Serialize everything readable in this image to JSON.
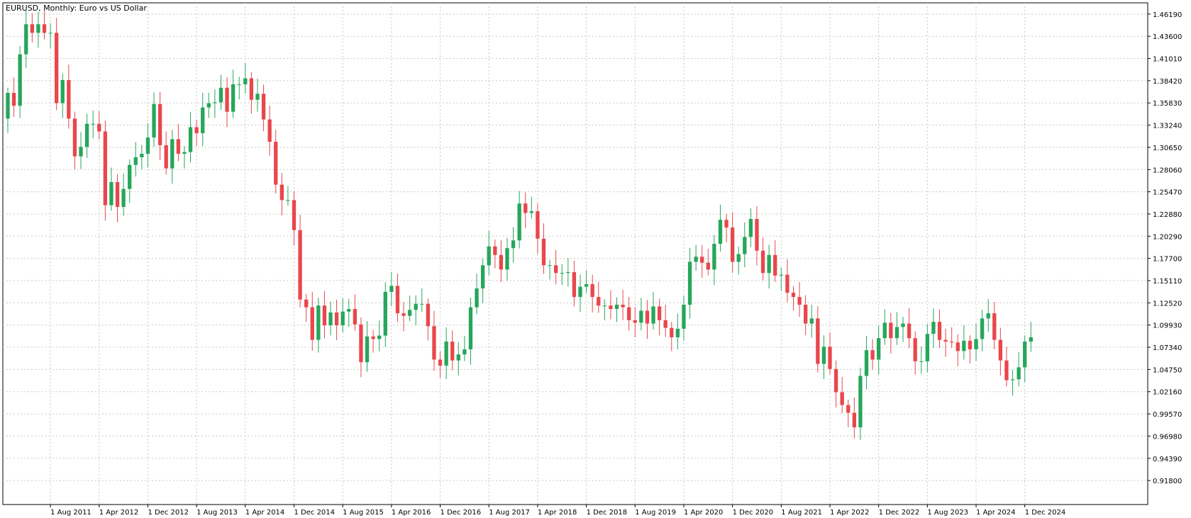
{
  "chart_data": {
    "type": "candlestick",
    "title": "EURUSD, Monthly:  Euro vs US Dollar",
    "ylim": [
      0.89,
      1.475
    ],
    "y_ticks": [
      "1.46190",
      "1.43600",
      "1.41010",
      "1.38420",
      "1.35830",
      "1.33240",
      "1.30650",
      "1.28060",
      "1.25470",
      "1.22880",
      "1.20290",
      "1.17700",
      "1.15110",
      "1.12520",
      "1.09930",
      "1.07340",
      "1.04750",
      "1.02160",
      "0.99570",
      "0.96980",
      "0.94390",
      "0.91800"
    ],
    "x_labels": [
      "1 Aug 2011",
      "1 Apr 2012",
      "1 Dec 2012",
      "1 Aug 2013",
      "1 Apr 2014",
      "1 Dec 2014",
      "1 Aug 2015",
      "1 Apr 2016",
      "1 Dec 2016",
      "1 Aug 2017",
      "1 Apr 2018",
      "1 Dec 2018",
      "1 Aug 2019",
      "1 Apr 2020",
      "1 Dec 2020",
      "1 Aug 2021",
      "1 Apr 2022",
      "1 Dec 2022",
      "1 Aug 2023",
      "1 Apr 2024",
      "1 Dec 2024"
    ],
    "start": "2011-01",
    "up_color": "#26a65b",
    "down_color": "#e8474c",
    "closes": [
      1.37,
      1.355,
      1.415,
      1.45,
      1.44,
      1.45,
      1.44,
      1.44,
      1.358,
      1.385,
      1.34,
      1.296,
      1.307,
      1.334,
      1.334,
      1.325,
      1.239,
      1.266,
      1.237,
      1.258,
      1.286,
      1.295,
      1.299,
      1.318,
      1.357,
      1.309,
      1.282,
      1.316,
      1.299,
      1.301,
      1.33,
      1.323,
      1.353,
      1.358,
      1.359,
      1.376,
      1.348,
      1.38,
      1.38,
      1.387,
      1.362,
      1.369,
      1.339,
      1.313,
      1.263,
      1.245,
      1.245,
      1.21,
      1.129,
      1.12,
      1.082,
      1.122,
      1.099,
      1.114,
      1.099,
      1.115,
      1.118,
      1.1,
      1.056,
      1.086,
      1.083,
      1.087,
      1.138,
      1.145,
      1.113,
      1.11,
      1.117,
      1.124,
      1.124,
      1.098,
      1.059,
      1.052,
      1.08,
      1.058,
      1.065,
      1.071,
      1.12,
      1.142,
      1.169,
      1.191,
      1.181,
      1.164,
      1.189,
      1.198,
      1.241,
      1.23,
      1.232,
      1.2,
      1.169,
      1.169,
      1.16,
      1.16,
      1.161,
      1.132,
      1.144,
      1.147,
      1.132,
      1.122,
      1.122,
      1.118,
      1.123,
      1.12,
      1.105,
      1.102,
      1.116,
      1.101,
      1.121,
      1.105,
      1.096,
      1.085,
      1.095,
      1.123,
      1.173,
      1.179,
      1.172,
      1.164,
      1.194,
      1.222,
      1.213,
      1.173,
      1.182,
      1.202,
      1.223,
      1.186,
      1.16,
      1.181,
      1.157,
      1.158,
      1.137,
      1.132,
      1.123,
      1.101,
      1.107,
      1.054,
      1.074,
      1.048,
      1.021,
      1.006,
      0.997,
      0.98,
      1.04,
      1.07,
      1.059,
      1.084,
      1.102,
      1.084,
      1.097,
      1.101,
      1.084,
      1.057,
      1.057,
      1.089,
      1.103,
      1.082,
      1.08,
      1.079,
      1.069,
      1.081,
      1.071,
      1.083,
      1.107,
      1.113,
      1.082,
      1.058,
      1.035,
      1.036,
      1.05,
      1.08,
      1.085
    ]
  }
}
